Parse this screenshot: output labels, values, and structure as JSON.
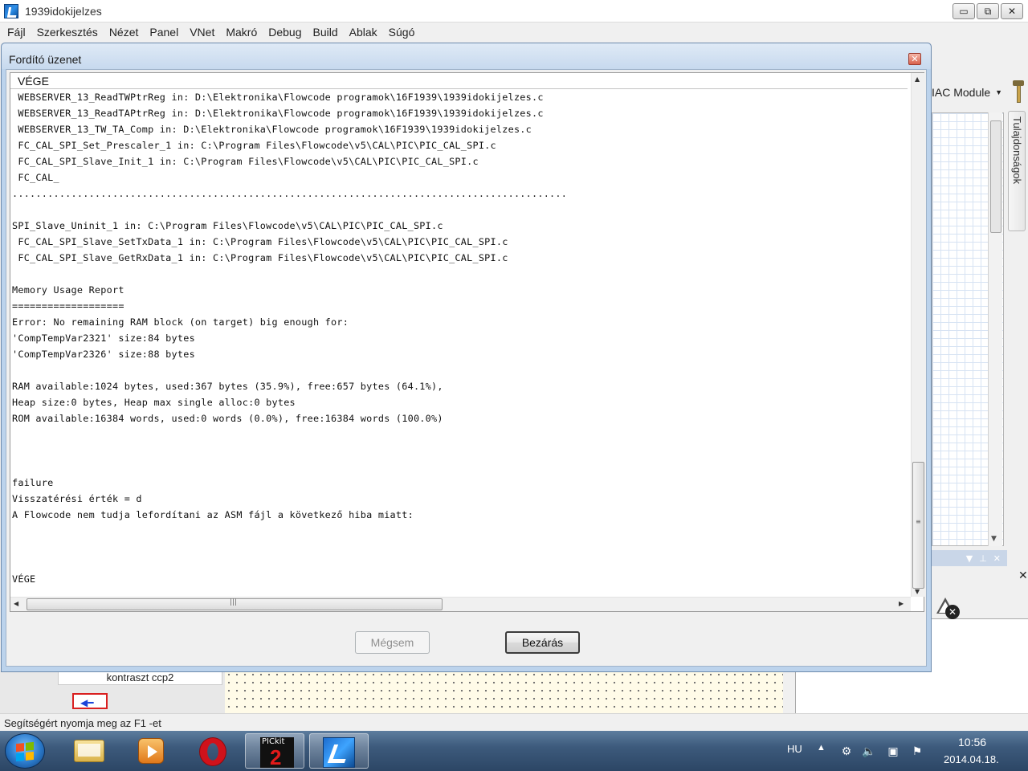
{
  "app": {
    "title": "1939idokijelzes",
    "window_buttons": {
      "minimize": "▭",
      "restore": "⧉",
      "close": "✕"
    },
    "menu": [
      "Fájl",
      "Szerkesztés",
      "Nézet",
      "Panel",
      "VNet",
      "Makró",
      "Debug",
      "Build",
      "Ablak",
      "Súgó"
    ]
  },
  "background": {
    "module_selector": "IAC Module",
    "side_tab": "Tulajdonságok",
    "flowchart_label": "kontraszt ccp2",
    "status": "Segítségért nyomja meg az F1 -et"
  },
  "dialog": {
    "title": "Fordító üzenet",
    "close_glyph": "✕",
    "header": "VÉGE",
    "lines": [
      " WEBSERVER_13_ReadTWPtrReg in: D:\\Elektronika\\Flowcode programok\\16F1939\\1939idokijelzes.c",
      " WEBSERVER_13_ReadTAPtrReg in: D:\\Elektronika\\Flowcode programok\\16F1939\\1939idokijelzes.c",
      " WEBSERVER_13_TW_TA_Comp in: D:\\Elektronika\\Flowcode programok\\16F1939\\1939idokijelzes.c",
      " FC_CAL_SPI_Set_Prescaler_1 in: C:\\Program Files\\Flowcode\\v5\\CAL\\PIC\\PIC_CAL_SPI.c",
      " FC_CAL_SPI_Slave_Init_1 in: C:\\Program Files\\Flowcode\\v5\\CAL\\PIC\\PIC_CAL_SPI.c",
      " FC_CAL_",
      "..............................................................................................",
      "",
      "SPI_Slave_Uninit_1 in: C:\\Program Files\\Flowcode\\v5\\CAL\\PIC\\PIC_CAL_SPI.c",
      " FC_CAL_SPI_Slave_SetTxData_1 in: C:\\Program Files\\Flowcode\\v5\\CAL\\PIC\\PIC_CAL_SPI.c",
      " FC_CAL_SPI_Slave_GetRxData_1 in: C:\\Program Files\\Flowcode\\v5\\CAL\\PIC\\PIC_CAL_SPI.c",
      "",
      "Memory Usage Report",
      "===================",
      "Error: No remaining RAM block (on target) big enough for:",
      "'CompTempVar2321' size:84 bytes",
      "'CompTempVar2326' size:88 bytes",
      "",
      "RAM available:1024 bytes, used:367 bytes (35.9%), free:657 bytes (64.1%),",
      "Heap size:0 bytes, Heap max single alloc:0 bytes",
      "ROM available:16384 words, used:0 words (0.0%), free:16384 words (100.0%)",
      "",
      "",
      "",
      "failure",
      "Visszatérési érték = d",
      "A Flowcode nem tudja lefordítani az ASM fájl a következő hiba miatt:",
      "",
      "",
      "",
      "VÉGE"
    ],
    "buttons": {
      "cancel": "Mégsem",
      "close": "Bezárás"
    }
  },
  "taskbar": {
    "pickit_label": "PICkit",
    "pickit_number": "2",
    "tray": {
      "language": "HU",
      "show_hidden": "▲",
      "time": "10:56",
      "date": "2014.04.18."
    }
  }
}
